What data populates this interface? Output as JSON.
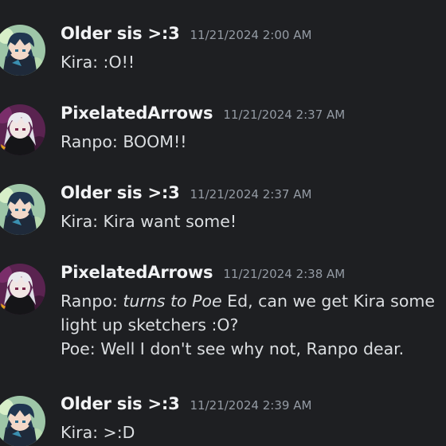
{
  "messages": [
    {
      "username": "Older sis >:3",
      "timestamp": "11/21/2024 2:00 AM",
      "lines": [
        "Kira: :O!!"
      ]
    },
    {
      "username": "PixelatedArrows",
      "timestamp": "11/21/2024 2:37 AM",
      "lines": [
        "Ranpo: BOOM!!"
      ]
    },
    {
      "username": "Older sis >:3",
      "timestamp": "11/21/2024 2:37 AM",
      "lines": [
        "Kira: Kira want some!"
      ]
    },
    {
      "username": "PixelatedArrows",
      "timestamp": "11/21/2024 2:38 AM",
      "line1_prefix": "Ranpo: ",
      "line1_italic": "turns to Poe",
      "line1_suffix": " Ed, can we get Kira some",
      "lines": [
        "light up sketchers :O?",
        "Poe: Well I don't see why not, Ranpo dear."
      ]
    },
    {
      "username": "Older sis >:3",
      "timestamp": "11/21/2024 2:39 AM",
      "lines": [
        "Kira: >:D"
      ]
    }
  ],
  "avatars": {
    "older_sis": "teal-haired-character-avatar",
    "pixelated_arrows": "white-haired-character-avatar"
  },
  "colors": {
    "background": "#1e1f22",
    "username": "#f2f3f5",
    "timestamp": "#949ba4",
    "text": "#dbdee1"
  }
}
